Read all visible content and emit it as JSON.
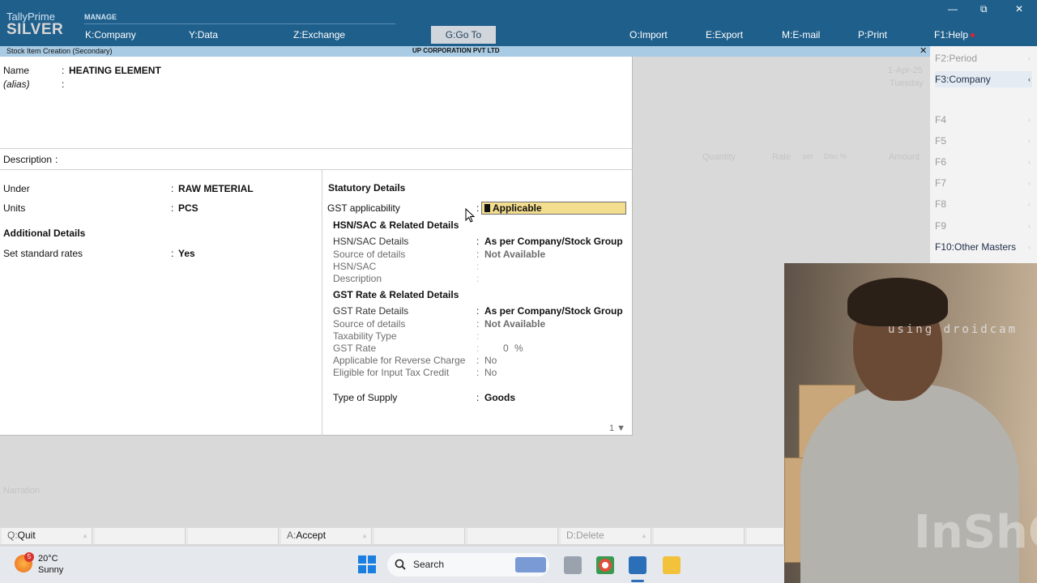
{
  "app": {
    "brand_line1": "TallyPrime",
    "brand_line2": "SILVER",
    "manage_label": "MANAGE"
  },
  "menu": {
    "company_key": "K:",
    "company": "Company",
    "data_key": "Y:",
    "data": "Data",
    "exchange_key": "Z:",
    "exchange": "Exchange",
    "goto_key": "G:",
    "goto": "Go To",
    "import_key": "O:",
    "import": "Import",
    "export_key": "E:",
    "export": "Export",
    "email_key": "M:",
    "email": "E-mail",
    "print_key": "P:",
    "print": "Print",
    "help_key": "F1:",
    "help": "Help"
  },
  "window_controls": {
    "minimize": "—",
    "restore": "⧉",
    "close": "✕"
  },
  "infobar": {
    "screen_title": "Stock Item Creation (Secondary)",
    "company_name": "UP CORPORATION PVT LTD",
    "close": "✕"
  },
  "right_panel": {
    "f2_key": "F2:",
    "f2": "Period",
    "f3_key": "F3:",
    "f3": "Company",
    "f4": "F4",
    "f5": "F5",
    "f6": "F6",
    "f7": "F7",
    "f8": "F8",
    "f9": "F9",
    "f10_key": "F10:",
    "f10": "Other Masters"
  },
  "background": {
    "date": "1-Apr-25",
    "day": "Tuesday",
    "quantity": "Quantity",
    "rate": "Rate",
    "per": "per",
    "disc": "Disc %",
    "amount": "Amount",
    "narration": "Narration"
  },
  "form": {
    "name_label": "Name",
    "name_value": "HEATING ELEMENT",
    "alias_label": "(alias)",
    "colon": ":",
    "description_label": "Description",
    "under_label": "Under",
    "under_value": "RAW METERIAL",
    "units_label": "Units",
    "units_value": "PCS",
    "additional_details": "Additional Details",
    "standard_rates_label": "Set standard rates",
    "standard_rates_value": "Yes"
  },
  "statutory": {
    "title": "Statutory Details",
    "gst_applicability_label": "GST applicability",
    "gst_applicability_value": "Applicable",
    "hsn_section": "HSN/SAC & Related Details",
    "hsn_details_label": "HSN/SAC Details",
    "hsn_details_value": "As per Company/Stock Group",
    "hsn_source_label": "Source of details",
    "hsn_source_value": "Not Available",
    "hsn_label": "HSN/SAC",
    "description_label": "Description",
    "gst_section": "GST Rate & Related Details",
    "gst_rate_details_label": "GST Rate Details",
    "gst_rate_details_value": "As per Company/Stock Group",
    "gst_source_label": "Source of details",
    "gst_source_value": "Not Available",
    "taxability_label": "Taxability Type",
    "gst_rate_label": "GST Rate",
    "gst_rate_value": "0",
    "gst_rate_unit": "%",
    "reverse_charge_label": "Applicable for Reverse Charge",
    "reverse_charge_value": "No",
    "itc_label": "Eligible for Input Tax Credit",
    "itc_value": "No",
    "supply_label": "Type of Supply",
    "supply_value": "Goods",
    "page_indicator": "1 ▼"
  },
  "bottom_bar": {
    "quit_key": "Q:",
    "quit": "Quit",
    "accept_key": "A:",
    "accept": "Accept",
    "delete_key": "D:",
    "delete": "Delete"
  },
  "taskbar": {
    "weather_badge": "5",
    "temperature": "20°C",
    "condition": "Sunny",
    "search": "Search"
  },
  "webcam": {
    "watermark": "using droidcam",
    "editor_watermark": "InShOt"
  },
  "colors": {
    "title_bar": "#1f5f8b",
    "info_bar": "#a9cbe3",
    "highlight": "#f3dd8e"
  }
}
